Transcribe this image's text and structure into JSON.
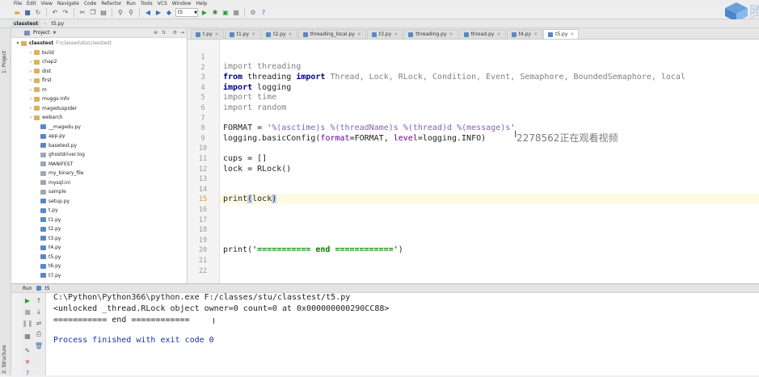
{
  "menu": [
    "File",
    "Edit",
    "View",
    "Navigate",
    "Code",
    "Refactor",
    "Run",
    "Tools",
    "VCS",
    "Window",
    "Help"
  ],
  "toolbar": {
    "run_config": "t5"
  },
  "breadcrumbs": [
    "classtest",
    "t5.py"
  ],
  "sidebar": {
    "vertical_tab": "1: Project",
    "structure_tab": "2: Structure",
    "header": "Project",
    "root": {
      "name": "classtest",
      "path": "F:\\classes\\stu\\classtest"
    },
    "folders": [
      "build",
      "chap2",
      "dist",
      "first",
      "m",
      "muggs-info",
      "mageduspider",
      "webarch"
    ],
    "files": [
      "__magedu.py",
      "app.py",
      "basetest.py",
      "ghostdriver.log",
      "MANIFEST",
      "my_binary_file",
      "mysql.ini",
      "sample",
      "setup.py",
      "t.py",
      "t1.py",
      "t2.py",
      "t3.py",
      "t4.py",
      "t5.py",
      "t6.py",
      "t7.py"
    ]
  },
  "tabs": [
    "t.py",
    "t1.py",
    "t2.py",
    "threading_local.py",
    "t3.py",
    "threading.py",
    "thread.py",
    "t4.py",
    "t5.py"
  ],
  "active_tab": "t5.py",
  "editor": {
    "line_numbers": [
      "1",
      "2",
      "3",
      "4",
      "5",
      "6",
      "7",
      "8",
      "9",
      "10",
      "11",
      "12",
      "13",
      "14",
      "15",
      "16",
      "17",
      "18",
      "19",
      "20",
      "21",
      "22"
    ],
    "code": {
      "l2": {
        "kw": "import",
        "rest": " threading"
      },
      "l3": {
        "kw": "from",
        "mod": " threading ",
        "kw2": "import",
        "rest": " Thread, Lock, RLock, Condition, Event, Semaphore, BoundedSemaphore, local"
      },
      "l4": {
        "kw": "import",
        "rest": " logging"
      },
      "l5": {
        "kw": "import",
        "rest": " time"
      },
      "l6": {
        "kw": "import",
        "rest": " random"
      },
      "l8": {
        "pre": "FORMAT = ",
        "q1": "'",
        "f1": "%(asctime)s",
        "sp1": " ",
        "f2": "%(threadName)s",
        "sp2": " ",
        "f3": "%(thread)d",
        "sp3": " ",
        "f4": "%(message)s",
        "q2": "'"
      },
      "l9": {
        "pre": "logging.basicConfig(",
        "p1": "format",
        "mid": "=FORMAT, ",
        "p2": "level",
        "post": "=logging.INFO)"
      },
      "l11": "cups = []",
      "l12": "lock = RLock()",
      "l15": {
        "fn": "print",
        "open": "(",
        "arg": "lock",
        "close": ")"
      },
      "l20": {
        "fn": "print(",
        "str": "'=========== end ============'",
        "close": ")"
      }
    }
  },
  "overlay_text": "2278562正在观看视频",
  "run": {
    "label": "Run",
    "config": "t5",
    "console": [
      "C:\\Python\\Python366\\python.exe F:/classes/stu/classtest/t5.py",
      "<unlocked _thread.RLock object owner=0 count=0 at 0x000000000290CC88>",
      "=========== end ============",
      "",
      "Process finished with exit code 0"
    ]
  }
}
